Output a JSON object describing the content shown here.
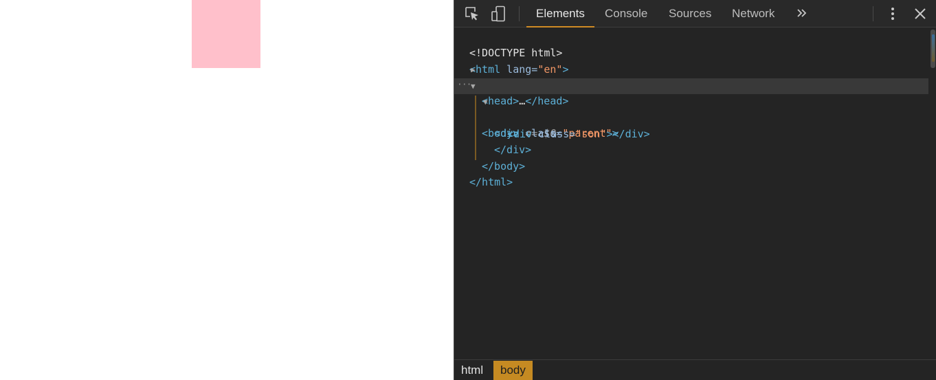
{
  "devtools": {
    "tabs": [
      {
        "label": "Elements",
        "active": true
      },
      {
        "label": "Console",
        "active": false
      },
      {
        "label": "Sources",
        "active": false
      },
      {
        "label": "Network",
        "active": false
      }
    ],
    "icons": [
      "inspect-element-icon",
      "device-toolbar-icon",
      "more-tabs-chevron-icon",
      "kebab-menu-icon",
      "close-icon"
    ]
  },
  "dom_tree": {
    "doctype": "<!DOCTYPE html>",
    "html_open": "<html",
    "html_attr_name": " lang=",
    "html_attr_val": "\"en\"",
    "html_close_bracket": ">",
    "head_collapsed": "<head>",
    "head_ellipsis": "…",
    "head_close": "</head>",
    "body_open": "<body>",
    "body_selected_marker": " == $0",
    "parent_open": "<div",
    "parent_attr_name": " class=",
    "parent_attr_val": "\"parent\"",
    "parent_close_bracket": ">",
    "son_open": "<div",
    "son_attr_name": " class=",
    "son_attr_val": "\"son\"",
    "son_close_bracket": "></div>",
    "parent_close": "</div>",
    "body_close": "</body>",
    "html_close": "</html>"
  },
  "breadcrumbs": [
    {
      "label": "html",
      "active": false
    },
    {
      "label": "body",
      "active": true
    }
  ],
  "colors": {
    "pink_box": "#ffc0cb",
    "devtools_bg": "#242424",
    "active_accent": "#d08b24",
    "tag": "#5db0d7",
    "attr_value": "#f29766"
  }
}
